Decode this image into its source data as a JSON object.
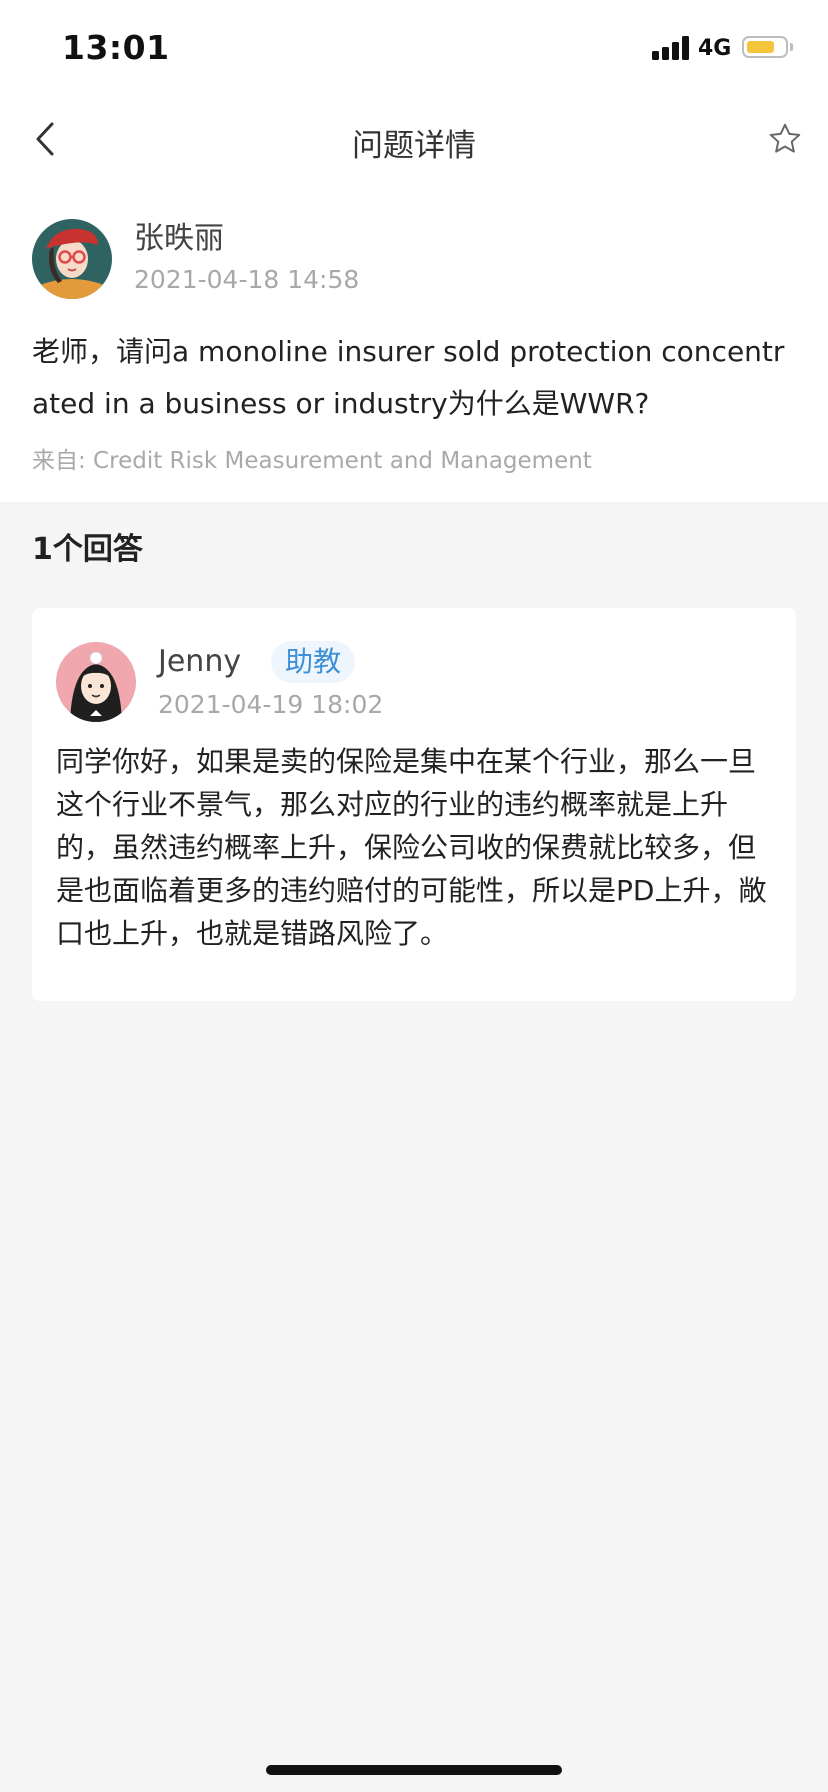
{
  "status_bar": {
    "time": "13:01",
    "network": "4G",
    "battery_level": 0.75,
    "battery_color": "#f4c43b"
  },
  "nav": {
    "title": "问题详情",
    "back_icon": "chevron-left-icon",
    "favorite_icon": "star-outline-icon"
  },
  "question": {
    "author_name": "张昳丽",
    "time": "2021-04-18 14:58",
    "text": "老师，请问a monoline insurer sold protection concentrated in a business or industry为什么是WWR?",
    "source": "来自: Credit Risk Measurement and Management"
  },
  "answers": {
    "header": "1个回答",
    "items": [
      {
        "author_name": "Jenny",
        "role": "助教",
        "time": "2021-04-19 18:02",
        "text": "同学你好，如果是卖的保险是集中在某个行业，那么一旦这个行业不景气，那么对应的行业的违约概率就是上升的，虽然违约概率上升，保险公司收的保费就比较多，但是也面临着更多的违约赔付的可能性，所以是PD上升，敞口也上升，也就是错路风险了。"
      }
    ]
  },
  "colors": {
    "accent": "#3d8fd6",
    "badge_bg": "#eef5fc",
    "page_bg": "#f5f5f5"
  }
}
